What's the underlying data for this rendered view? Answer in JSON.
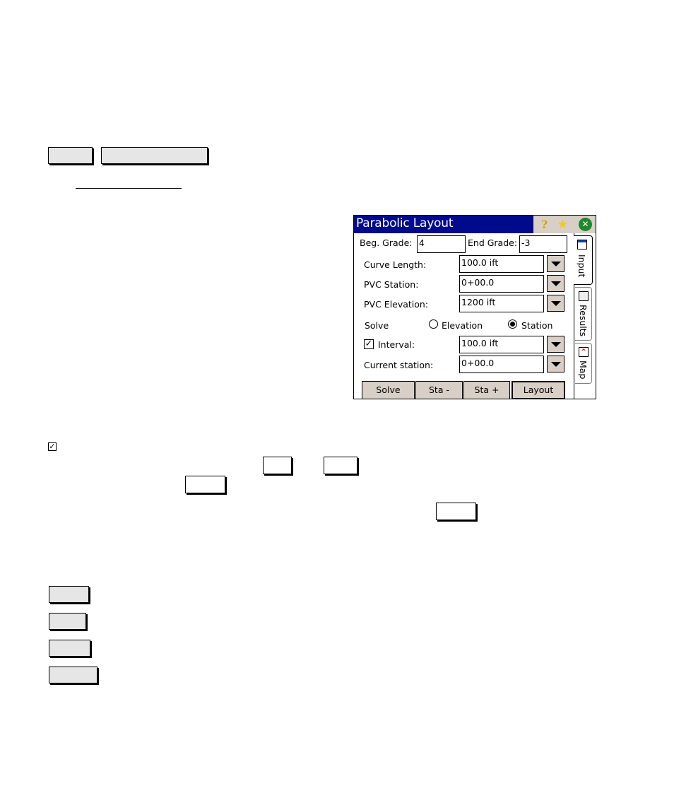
{
  "document": {
    "header_buttons": [
      {
        "label": ""
      },
      {
        "label": ""
      }
    ],
    "inline_buttons": [
      {
        "label": ""
      },
      {
        "label": ""
      },
      {
        "label": ""
      },
      {
        "label": ""
      }
    ],
    "list_buttons": [
      {
        "label": ""
      },
      {
        "label": ""
      },
      {
        "label": ""
      },
      {
        "label": ""
      }
    ],
    "checkbox_glyph": "☑"
  },
  "screen": {
    "title": "Parabolic Layout",
    "title_icons": {
      "help": "?",
      "favorite": "★",
      "close": "✕"
    },
    "beg_grade": {
      "label": "Beg. Grade:",
      "value": "4"
    },
    "end_grade": {
      "label": "End Grade:",
      "value": "-3"
    },
    "curve_length": {
      "label": "Curve Length:",
      "value": "100.0 ift"
    },
    "pvc_station": {
      "label": "PVC Station:",
      "value": "0+00.0"
    },
    "pvc_elevation": {
      "label": "PVC Elevation:",
      "value": "1200 ift"
    },
    "solve": {
      "label": "Solve",
      "options": [
        {
          "label": "Elevation",
          "selected": false
        },
        {
          "label": "Station",
          "selected": true
        }
      ]
    },
    "interval": {
      "label": "Interval:",
      "checked": true,
      "value": "100.0 ift"
    },
    "current_station": {
      "label": "Current station:",
      "value": "0+00.0"
    },
    "buttons": {
      "solve": "Solve",
      "sta_minus": "Sta -",
      "sta_plus": "Sta +",
      "layout": "Layout"
    },
    "tabs": [
      {
        "label": "Input",
        "active": true
      },
      {
        "label": "Results",
        "active": false
      },
      {
        "label": "Map",
        "active": false
      }
    ]
  }
}
